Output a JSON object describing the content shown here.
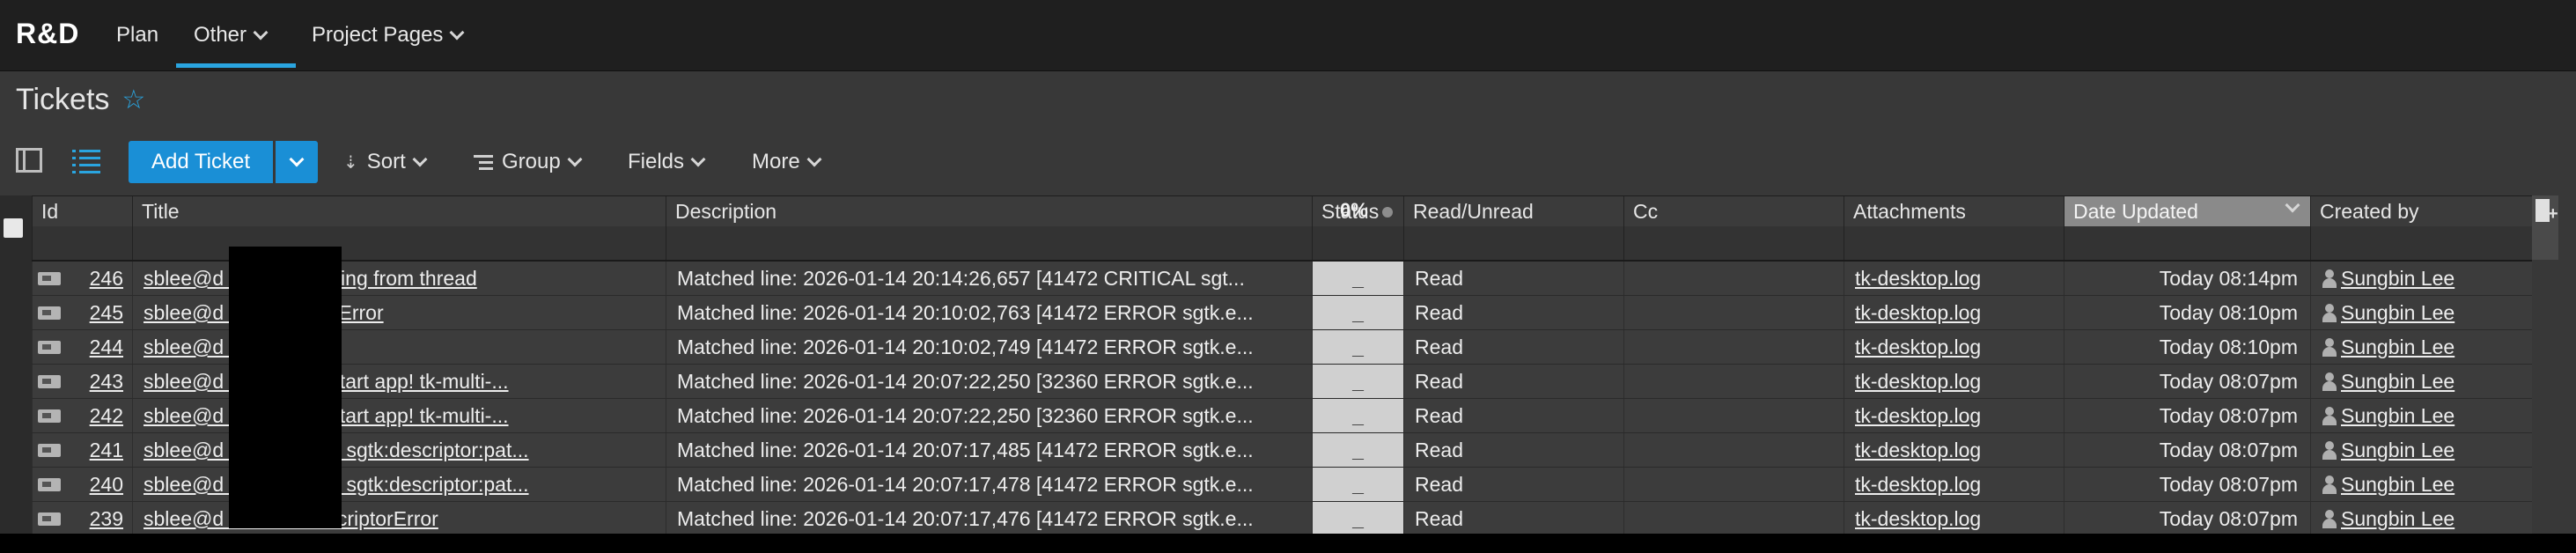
{
  "nav": {
    "brand": "R&D",
    "items": [
      {
        "label": "Plan"
      },
      {
        "label": "Other"
      },
      {
        "label": "Project Pages"
      }
    ]
  },
  "page": {
    "title": "Tickets"
  },
  "toolbar": {
    "add_ticket": "Add Ticket",
    "sort": "Sort",
    "group": "Group",
    "fields": "Fields",
    "more": "More"
  },
  "columns": {
    "id": "Id",
    "title": "Title",
    "description": "Description",
    "status": "Status",
    "read_unread": "Read/Unread",
    "cc": "Cc",
    "attachments": "Attachments",
    "date_updated": "Date Updated",
    "created_by": "Created by"
  },
  "summary": {
    "status_percent": "0%"
  },
  "rows": [
    {
      "id": "246",
      "title": "sblee@d            n - while calling from thread",
      "description": "Matched line: 2026-01-14 20:14:26,657 [41472 CRITICAL sgt...",
      "status": "_",
      "read": "Read",
      "cc": "",
      "attachment": "tk-desktop.log",
      "date": "Today 08:14pm",
      "created_by": "Sungbin Lee"
    },
    {
      "id": "245",
      "title": "sblee@d            n - OverflowError",
      "description": "Matched line: 2026-01-14 20:10:02,763 [41472 ERROR sgtk.e...",
      "status": "_",
      "read": "Read",
      "cc": "",
      "attachment": "tk-desktop.log",
      "date": "Today 08:10pm",
      "created_by": "Sungbin Lee"
    },
    {
      "id": "244",
      "title": "sblee@d            n - Error",
      "description": "Matched line: 2026-01-14 20:10:02,749 [41472 ERROR sgtk.e...",
      "status": "_",
      "read": "Read",
      "cc": "",
      "attachment": "tk-desktop.log",
      "date": "Today 08:10pm",
      "created_by": "Sungbin Lee"
    },
    {
      "id": "243",
      "title": "sblee@d            n - Cannot start app! tk-multi-...",
      "description": "Matched line: 2026-01-14 20:07:22,250 [32360 ERROR sgtk.e...",
      "status": "_",
      "read": "Read",
      "cc": "",
      "attachment": "tk-desktop.log",
      "date": "Today 08:07pm",
      "created_by": "Sungbin Lee"
    },
    {
      "id": "242",
      "title": "sblee@d            n - Cannot start app! tk-multi-...",
      "description": "Matched line: 2026-01-14 20:07:22,250 [32360 ERROR sgtk.e...",
      "status": "_",
      "read": "Read",
      "cc": "",
      "attachment": "tk-desktop.log",
      "date": "Today 08:07pm",
      "created_by": "Sungbin Lee"
    },
    {
      "id": "241",
      "title": "sblee@d            n - [PROXY] sgtk:descriptor:pat...",
      "description": "Matched line: 2026-01-14 20:07:17,485 [41472 ERROR sgtk.e...",
      "status": "_",
      "read": "Read",
      "cc": "",
      "attachment": "tk-desktop.log",
      "date": "Today 08:07pm",
      "created_by": "Sungbin Lee"
    },
    {
      "id": "240",
      "title": "sblee@d            n - [PROXY] sgtk:descriptor:pat...",
      "description": "Matched line: 2026-01-14 20:07:17,478 [41472 ERROR sgtk.e...",
      "status": "_",
      "read": "Read",
      "cc": "",
      "attachment": "tk-desktop.log",
      "date": "Today 08:07pm",
      "created_by": "Sungbin Lee"
    },
    {
      "id": "239",
      "title": "sblee@d            n - TankDescriptorError",
      "description": "Matched line: 2026-01-14 20:07:17,476 [41472 ERROR sgtk.e...",
      "status": "_",
      "read": "Read",
      "cc": "",
      "attachment": "tk-desktop.log",
      "date": "Today 08:07pm",
      "created_by": "Sungbin Lee"
    }
  ],
  "icons": {
    "favorite": "star-icon",
    "row_type": "ticket-icon",
    "user": "user-icon"
  },
  "colors": {
    "accent": "#2aa5e0",
    "button": "#1a8fd6"
  }
}
